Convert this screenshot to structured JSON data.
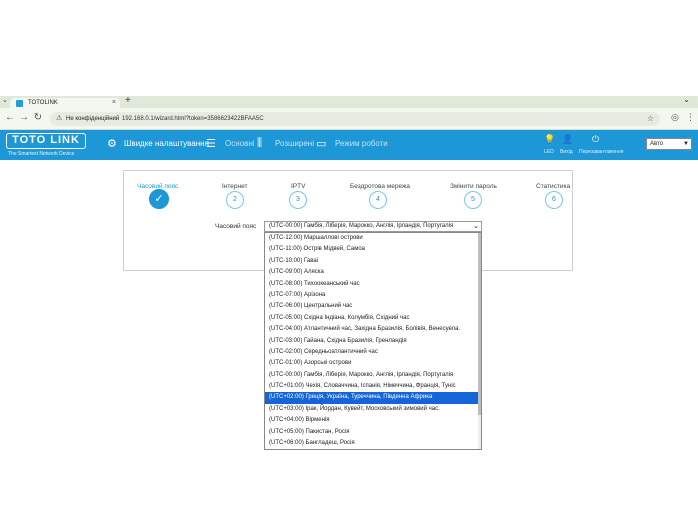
{
  "browser": {
    "tab_title": "TOTOLINK",
    "tab_close": "×",
    "new_tab": "+",
    "security_label": "Не конфіденційний",
    "url": "192.168.0.1/wizard.html?token=3586623422BFAA5C"
  },
  "header": {
    "logo_text": "TOTO LINK",
    "tagline": "The Smartest Network Device",
    "nav": {
      "quick_setup": "Швидке налаштування",
      "basic": "Основні",
      "advanced": "Розширені",
      "mode": "Режим роботи"
    },
    "right": {
      "led": "LED",
      "logout": "Вихід",
      "reboot": "Перезавантаження"
    },
    "language": "Авто"
  },
  "wizard": {
    "steps": [
      {
        "label": "Часовий пояс",
        "number": "✓",
        "done": true
      },
      {
        "label": "Інтернет",
        "number": "2"
      },
      {
        "label": "IPTV",
        "number": "3"
      },
      {
        "label": "Бездротова мережа",
        "number": "4"
      },
      {
        "label": "Змінити пароль",
        "number": "5"
      },
      {
        "label": "Статистика",
        "number": "6"
      }
    ],
    "timezone_label": "Часовий пояс",
    "timezone_selected": "(UTC-00:00) Гамбія, Ліберія, Марокко, Англія, Ірландія, Португалія",
    "options": [
      "(UTC-12:00) Маршаллові острови",
      "(UTC-11:00) Острів Мідвей, Самоа",
      "(UTC-10:00) Гаваї",
      "(UTC-09:00) Аляска",
      "(UTC-08:00) Тихоокеанський час",
      "(UTC-07:00) Арізона",
      "(UTC-06:00) Центральний час",
      "(UTC-05:00) Східна Індіана, Колумбія, Східний час",
      "(UTC-04:00) Атлантичний час, Західна Бразилія, Болівія, Венесуела.",
      "(UTC-03:00) Гайана, Східна Бразилія, Гренландія",
      "(UTC-02:00) Середньоатлантичний час",
      "(UTC-01:00) Азорські острови",
      "(UTC-00:00) Гамбія, Ліберія, Марокко, Англія, Ірландія, Португалія",
      "(UTC+01:00) Чехія, Словаччина, Іспанія, Німеччина, Франція, Туніс",
      "(UTC+02:00) Греція, Україна, Туреччина, Південна Африка",
      "(UTC+03:00) Ірак, Йордан, Кувейт, Московський зимовий час.",
      "(UTC+04:00) Вірменія",
      "(UTC+05:00) Пакистан, Росія",
      "(UTC+06:00) Бангладеш, Росія"
    ],
    "highlighted_index": 14
  }
}
